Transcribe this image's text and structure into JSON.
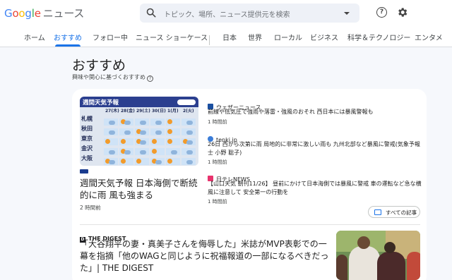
{
  "header": {
    "logo_letters": [
      "G",
      "o",
      "o",
      "g",
      "l",
      "e"
    ],
    "product": "ニュース",
    "search_placeholder": "トピック、場所、ニュース提供元を検索",
    "help_label": "?"
  },
  "nav": {
    "tabs": [
      {
        "label": "ホーム"
      },
      {
        "label": "おすすめ",
        "active": true
      },
      {
        "label": "フォロー中"
      },
      {
        "label": "ニュース ショーケース"
      },
      {
        "label": "日本"
      },
      {
        "label": "世界"
      },
      {
        "label": "ローカル"
      },
      {
        "label": "ビジネス"
      },
      {
        "label": "科学＆テクノロジー"
      },
      {
        "label": "エンタメ"
      }
    ],
    "accent_color": "#1a73e8"
  },
  "page": {
    "title": "おすすめ",
    "subtitle": "興味や関心に基づくおすすめ",
    "subtitle_icon": "?"
  },
  "main_story": {
    "image": {
      "title": "週間天気予報",
      "dates": [
        "27(木)",
        "28(金)",
        "29(土)",
        "30(日)",
        "1(月)",
        "2(火)",
        "3(水)"
      ],
      "cities": [
        "札幌",
        "秋田",
        "東京",
        "金沢",
        "大阪"
      ]
    },
    "headline": "週間天気予報 日本海側で断続的に雨 風も強まる",
    "time": "2 時間前"
  },
  "side_stories": [
    {
      "source": "ウェザーニュース",
      "icon": "weathernews-logo-icon",
      "icon_color": "#1a4fa0",
      "headline": "前線や低気圧で強雨や落雷・強風のおそれ 西日本には暴風警報も",
      "time": "1 時間前"
    },
    {
      "source": "tenki.jp",
      "icon": "tenkijp-logo-icon",
      "icon_color": "#3b7dd8",
      "headline": "26日 西から次第に雨 局地的に非常に激しい雨も 九州北部など暴風に警戒(気象予報士 小野 聡子)",
      "time": "1 時間前"
    },
    {
      "source": "日テレNEWS",
      "icon": "ntv-logo-icon",
      "icon_color": "#e8336d",
      "headline": "【山口天気 朝刊11/26】 昼前にかけて日本海側では暴風に警戒 車の運転など急な横風に注意して 安全第一の行動を",
      "time": "1 時間前"
    }
  ],
  "all_articles_label": "すべての記事",
  "digest_story": {
    "source": "THE DIGEST",
    "source_icon_letter": "D",
    "headline": "「大谷翔平の妻・真美子さんを侮辱した」米誌がMVP表彰での一幕を指摘「他のWAGと同じように祝福報道の一部になるべきだった」| THE DIGEST"
  }
}
